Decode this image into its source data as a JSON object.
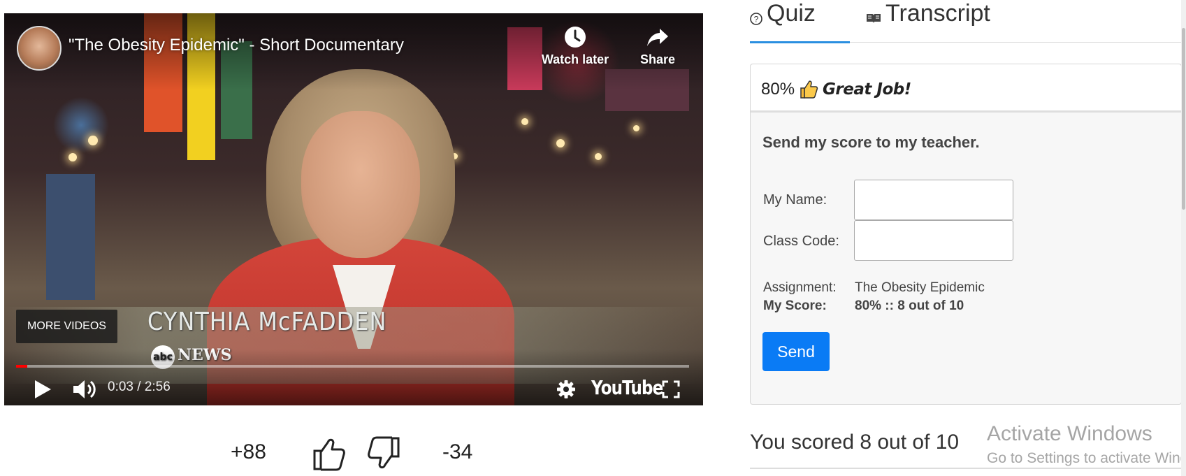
{
  "player": {
    "title": "\"The Obesity Epidemic\" - Short Documentary",
    "watch_later_label": "Watch later",
    "share_label": "Share",
    "more_videos_label": "MORE VIDEOS",
    "lower_third_name": "CYNTHIA  McFADDEN",
    "lower_third_logo": "abc",
    "lower_third_network": "NEWS",
    "time_current": "0:03",
    "time_separator": " / ",
    "time_total": "2:56",
    "progress_fraction": 0.017,
    "brand": "YouTube",
    "accent_color": "#ff0000"
  },
  "votes": {
    "up": "+88",
    "down": "-34"
  },
  "tabs": [
    {
      "label": "Quiz",
      "icon": "question-circle-icon",
      "active": true
    },
    {
      "label": "Transcript",
      "icon": "book-open-icon",
      "active": false
    }
  ],
  "result": {
    "percent": "80%",
    "praise": "Great Job!",
    "send_heading": "Send my score to my teacher.",
    "name_label": "My Name:",
    "name_value": "",
    "class_code_label": "Class Code:",
    "class_code_value": "",
    "assignment_label": "Assignment:",
    "assignment_value": "The Obesity Epidemic",
    "score_label": "My Score:",
    "score_value": "80% :: 8 out of 10",
    "send_label": "Send",
    "send_color": "#0a7bf5"
  },
  "summary": {
    "scored_text": "You scored 8 out of 10"
  },
  "watermark": {
    "title": "Activate Windows",
    "subtitle": "Go to Settings to activate Windows."
  }
}
